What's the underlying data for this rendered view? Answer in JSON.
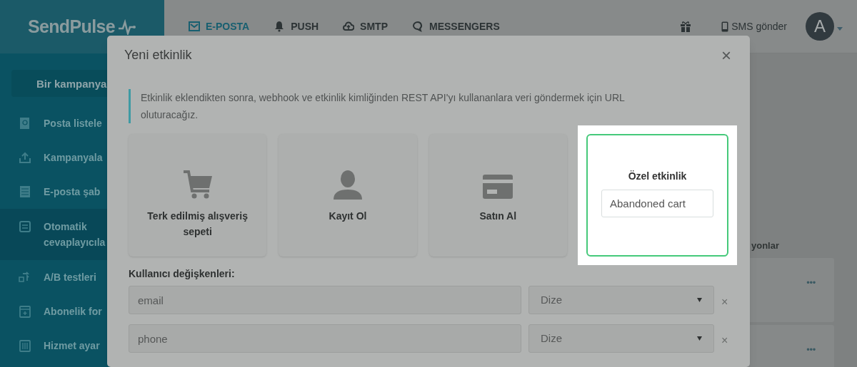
{
  "logo": {
    "text": "SendPulse"
  },
  "top_nav": [
    {
      "label": "E-POSTA",
      "selected": true
    },
    {
      "label": "PUSH",
      "selected": false
    },
    {
      "label": "SMTP",
      "selected": false
    },
    {
      "label": "MESSENGERS",
      "selected": false
    }
  ],
  "header_actions": {
    "sms": "SMS gönder",
    "avatar": "A"
  },
  "sidebar": {
    "create_button": "Bir kampanya",
    "items": [
      {
        "label": "Posta listele",
        "selected": false
      },
      {
        "label": "Kampanyala",
        "selected": false
      },
      {
        "label": "E-posta şab",
        "selected": false
      },
      {
        "label": "Otomatik cevaplayıcıla",
        "selected": true
      },
      {
        "label": "A/B testleri",
        "selected": false
      },
      {
        "label": "Abonelik for",
        "selected": false
      },
      {
        "label": "Hizmet ayar",
        "selected": false
      }
    ]
  },
  "background": {
    "column_label": "yonlar",
    "cards": [
      {
        "menu": "•••"
      },
      {
        "menu": "•••"
      }
    ]
  },
  "modal": {
    "title": "Yeni etkinlik",
    "close": "×",
    "info": "Etkinlik eklendikten sonra, webhook ve etkinlik kimliğinden REST API'yı kullananlara veri göndermek için URL oluturacağız.",
    "event_types": [
      {
        "kind": "cart",
        "label": "Terk edilmiş alışveriş sepeti",
        "selected": false
      },
      {
        "kind": "person",
        "label": "Kayıt Ol",
        "selected": false
      },
      {
        "kind": "card",
        "label": "Satın Al",
        "selected": false
      },
      {
        "kind": "custom",
        "label": "Özel etkinlik",
        "value": "Abandoned cart",
        "selected": true
      }
    ],
    "variables_label": "Kullanıcı değişkenleri:",
    "variables": [
      {
        "name": "email",
        "type": "Dize",
        "remove": "×"
      },
      {
        "name": "phone",
        "type": "Dize",
        "remove": "×"
      }
    ]
  }
}
